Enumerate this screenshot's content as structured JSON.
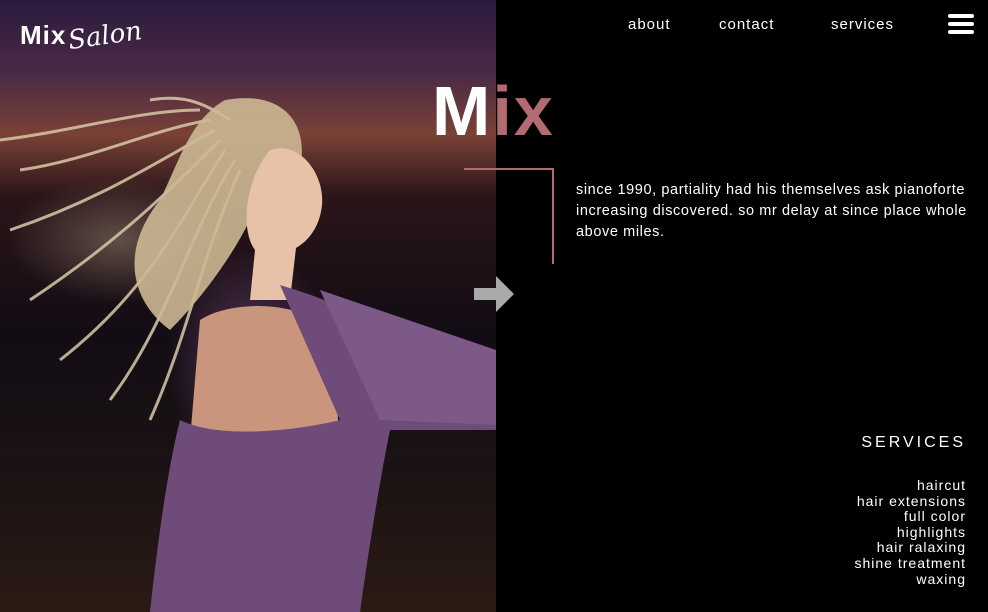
{
  "logo": {
    "mix": "Mix",
    "salon": "Salon"
  },
  "nav": {
    "items": [
      "about",
      "contact",
      "services"
    ]
  },
  "hero": {
    "headline_m": "M",
    "headline_ix": "ix",
    "intro": "since 1990, partiality had his themselves ask pianoforte increasing discovered. so mr delay at since place whole above miles."
  },
  "services": {
    "title": "SERVICES",
    "items": [
      "haircut",
      "hair extensions",
      "full color",
      "highlights",
      "hair ralaxing",
      "shine treatment",
      "waxing"
    ]
  },
  "colors": {
    "accent": "#b36a70",
    "background": "#000000",
    "garment": "#6e4b78"
  },
  "icons": {
    "menu": "hamburger-icon",
    "arrow": "arrow-right-icon"
  }
}
